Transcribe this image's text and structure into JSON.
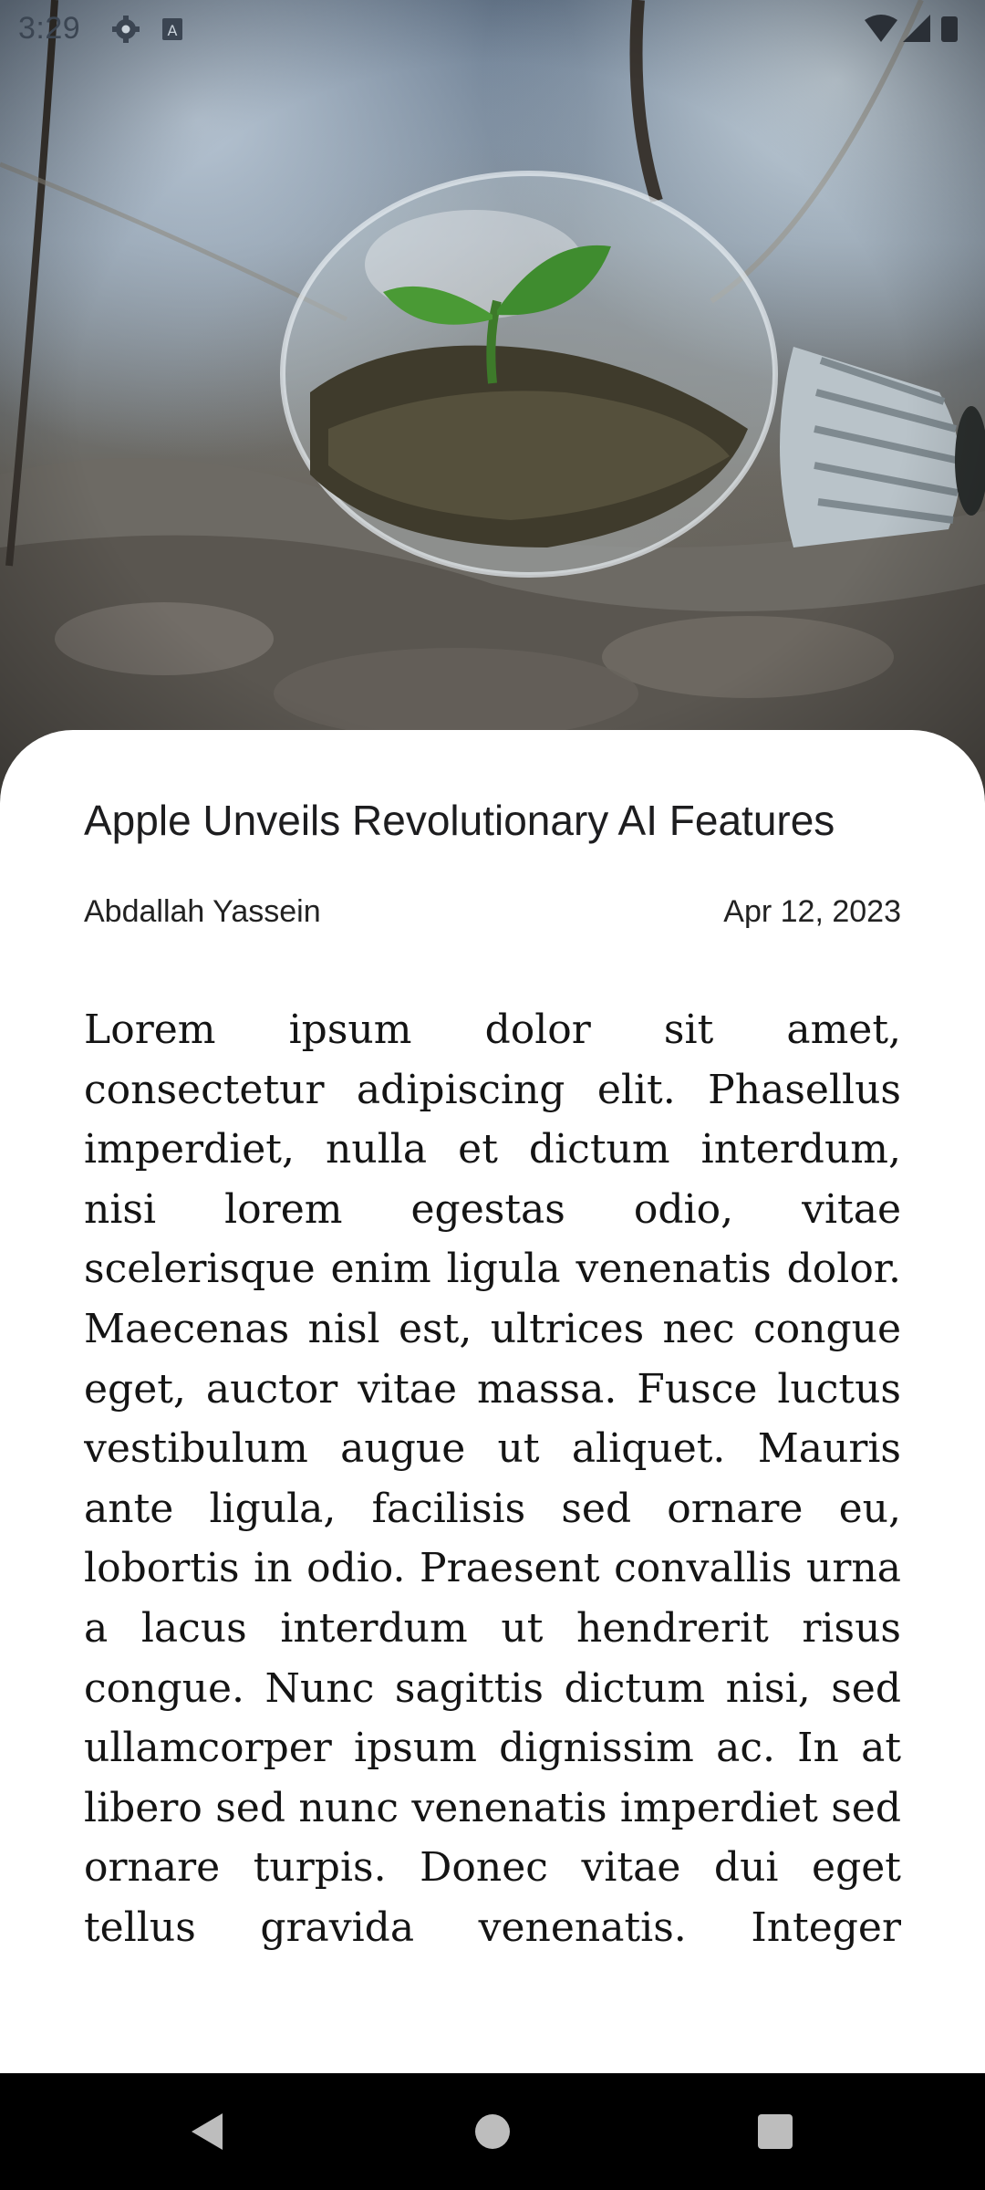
{
  "status_bar": {
    "time": "3:29",
    "left_icons": [
      "settings-gear-icon",
      "keyboard-a-icon"
    ],
    "right_icons": [
      "wifi-icon",
      "cell-signal-icon",
      "battery-icon"
    ]
  },
  "hero": {
    "image": "lightbulb-with-seedling-photo"
  },
  "article": {
    "title": "Apple Unveils Revolutionary AI Features",
    "author": "Abdallah Yassein",
    "date": "Apr 12, 2023",
    "body": "Lorem ipsum dolor sit amet, consectetur adipiscing elit. Phasellus imperdiet, nulla et dictum interdum, nisi lorem egestas odio, vitae scelerisque enim ligula venenatis dolor. Maecenas nisl est, ultrices nec congue eget, auctor vitae massa. Fusce luctus vestibulum augue ut aliquet. Mauris ante ligula, facilisis sed ornare eu, lobortis in odio. Praesent convallis urna a lacus interdum ut hendrerit risus congue. Nunc sagittis dictum nisi, sed ullamcorper ipsum dignissim ac. In at libero sed nunc venenatis imperdiet sed ornare turpis. Donec vitae dui eget tellus gravida venenatis. Integer"
  },
  "nav_bar": {
    "buttons": [
      "back-icon",
      "home-icon",
      "recents-icon"
    ]
  },
  "colors": {
    "card_background": "#ffffff",
    "text_primary": "#1d1d1f",
    "nav_background": "#000000"
  }
}
